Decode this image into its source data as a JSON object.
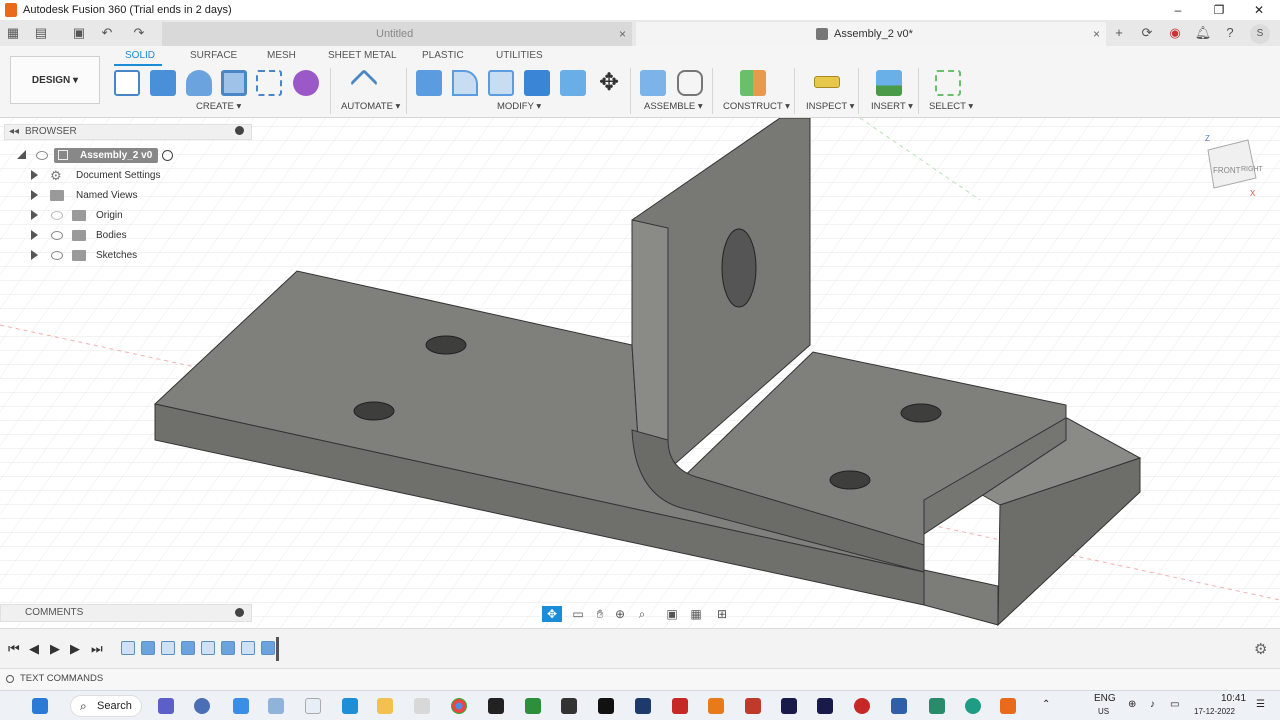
{
  "window": {
    "title": "Autodesk Fusion 360 (Trial ends in 2 days)",
    "minimize": "–",
    "restore": "❐",
    "close": "✕"
  },
  "tabs": {
    "untitled": "Untitled",
    "assembly": "Assembly_2 v0*",
    "user_initial": "S"
  },
  "ribbon": {
    "tabs": [
      "SOLID",
      "SURFACE",
      "MESH",
      "SHEET METAL",
      "PLASTIC",
      "UTILITIES"
    ],
    "workspace": "DESIGN",
    "groups": [
      "CREATE",
      "AUTOMATE",
      "MODIFY",
      "ASSEMBLE",
      "CONSTRUCT",
      "INSPECT",
      "INSERT",
      "SELECT"
    ]
  },
  "browser": {
    "title": "BROWSER",
    "root": "Assembly_2 v0",
    "items": [
      "Document Settings",
      "Named Views",
      "Origin",
      "Bodies",
      "Sketches"
    ]
  },
  "comments": "COMMENTS",
  "text_commands": "TEXT COMMANDS",
  "viewcube": {
    "front": "FRONT",
    "right": "RIGHT",
    "z": "Z",
    "x": "X"
  },
  "taskbar": {
    "search": "Search",
    "lang": "ENG",
    "lang2": "US",
    "time": "10:41",
    "date": "17-12-2022"
  }
}
